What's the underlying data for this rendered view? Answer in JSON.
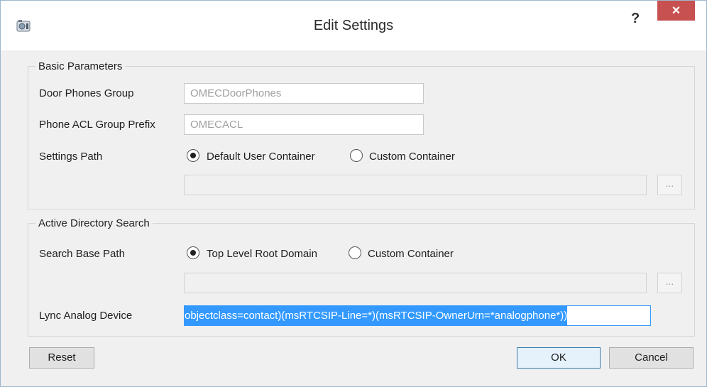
{
  "window": {
    "title": "Edit Settings",
    "help_label": "?",
    "close_label": "×"
  },
  "basic": {
    "legend": "Basic Parameters",
    "door_phones_label": "Door Phones Group",
    "door_phones_value": "OMECDoorPhones",
    "acl_prefix_label": "Phone ACL Group Prefix",
    "acl_prefix_value": "OMECACL",
    "settings_path_label": "Settings Path",
    "radio_default": "Default User Container",
    "radio_custom": "Custom Container",
    "selected": "Default User Container",
    "container_path_value": "",
    "browse_label": "..."
  },
  "ad_search": {
    "legend": "Active Directory Search",
    "search_base_label": "Search Base Path",
    "radio_top": "Top Level Root Domain",
    "radio_custom": "Custom Container",
    "selected": "Top Level Root Domain",
    "container_path_value": "",
    "browse_label": "...",
    "lync_label": "Lync Analog Device",
    "lync_value": "objectclass=contact)(msRTCSIP-Line=*)(msRTCSIP-OwnerUrn=*analogphone*))"
  },
  "buttons": {
    "reset": "Reset",
    "ok": "OK",
    "cancel": "Cancel"
  },
  "colors": {
    "close_button": "#c75050",
    "selection": "#3399ff",
    "default_button_border": "#3c7fb1"
  }
}
